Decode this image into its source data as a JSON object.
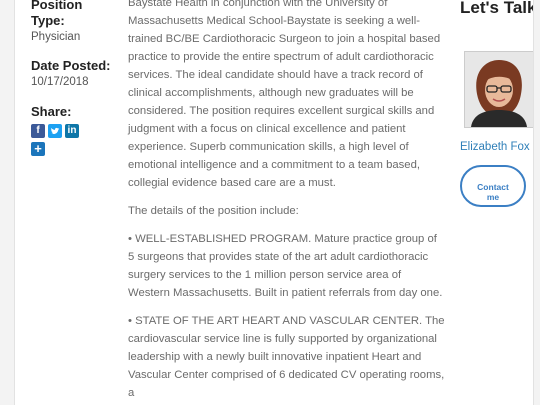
{
  "sidebar": {
    "position_type_label": "Position Type:",
    "position_type_value": "Physician",
    "date_posted_label": "Date Posted:",
    "date_posted_value": "10/17/2018",
    "share_label": "Share:",
    "share_icons": [
      "facebook-icon",
      "twitter-icon",
      "linkedin-icon",
      "add-icon"
    ],
    "share_colors": {
      "facebook": "#3b5998",
      "twitter": "#1da1f2",
      "linkedin": "#0e76a8",
      "add": "#1b75bb"
    }
  },
  "main": {
    "intro": "Baystate Health in conjunction with the University of Massachusetts Medical School-Baystate is seeking a well-trained BC/BE Cardiothoracic Surgeon to join a hospital based practice to provide the entire spectrum of adult cardiothoracic services. The ideal candidate should have a track record of clinical accomplishments, although new graduates will be considered. The position requires excellent surgical skills and judgment with a focus on clinical excellence and patient experience. Superb communication skills, a high level of emotional intelligence and a commitment to a team based, collegial evidence based care are a must.",
    "details_heading": "The details of the position include:",
    "bullet1": "• WELL-ESTABLISHED PROGRAM. Mature practice group of 5 surgeons that provides state of the art adult cardiothoracic surgery services to the 1 million person service area of Western Massachusetts. Built in patient referrals from day one.",
    "bullet2": "• STATE OF THE ART HEART AND VASCULAR CENTER. The cardiovascular service line is fully supported by organizational leadership with a newly built innovative inpatient Heart and Vascular Center comprised of 6 dedicated CV operating rooms, a"
  },
  "contact_panel": {
    "title": "Let's Talk",
    "recruiter_name": "Elizabeth Fox",
    "contact_button": "Contact me",
    "accent_color": "#3b7fc4"
  }
}
